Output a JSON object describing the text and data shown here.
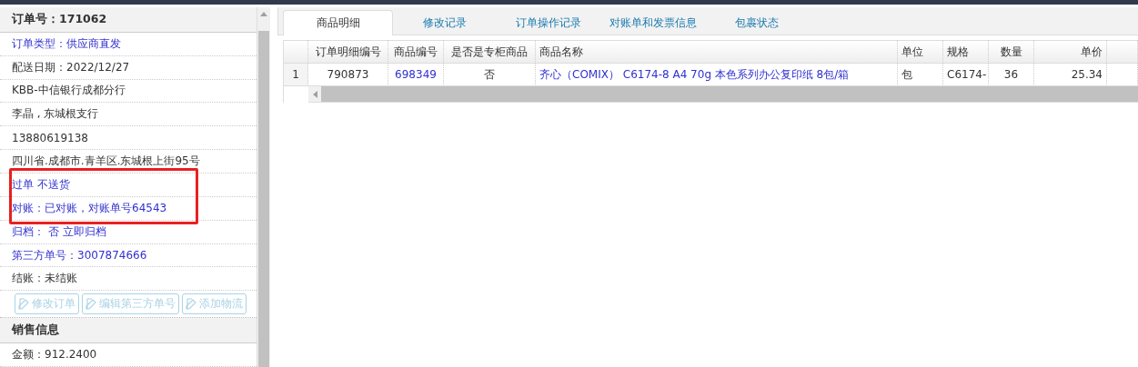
{
  "order_panel": {
    "title": "订单号：171062",
    "rows": [
      {
        "text": "订单类型：供应商直发",
        "kind": "link"
      },
      {
        "text": "配送日期：2022/12/27",
        "kind": "plain"
      },
      {
        "text": "KBB-中信银行成都分行",
        "kind": "plain"
      },
      {
        "text": "李晶 , 东城根支行",
        "kind": "plain"
      },
      {
        "text": "13880619138",
        "kind": "plain"
      },
      {
        "text": "四川省.成都市.青羊区.东城根上街95号",
        "kind": "plain"
      },
      {
        "text": "过单 不送货",
        "kind": "link"
      },
      {
        "text": "对账：已对账，对账单号64543",
        "kind": "link"
      },
      {
        "text": "归档：  否 立即归档",
        "kind": "link"
      },
      {
        "text": "第三方单号：3007874666",
        "kind": "link"
      },
      {
        "text": "结账：未结账",
        "kind": "plain"
      }
    ],
    "buttons": [
      {
        "label": "修改订单",
        "disabled": true
      },
      {
        "label": "编辑第三方单号",
        "disabled": true
      },
      {
        "label": "添加物流",
        "disabled": true
      }
    ]
  },
  "sales_panel": {
    "title": "销售信息",
    "rows": [
      {
        "text": "金额：912.2400",
        "kind": "plain"
      }
    ]
  },
  "tabs": [
    {
      "label": "商品明细",
      "selected": true
    },
    {
      "label": "修改记录",
      "selected": false
    },
    {
      "label": "订单操作记录",
      "selected": false
    },
    {
      "label": "对账单和发票信息",
      "selected": false
    },
    {
      "label": "包裹状态",
      "selected": false
    }
  ],
  "table": {
    "columns": [
      "订单明细编号",
      "商品编号",
      "是否是专柜商品",
      "商品名称",
      "单位",
      "规格",
      "数量",
      "单价"
    ],
    "rows": [
      {
        "index": "1",
        "cells": [
          "790873",
          "698349",
          "否",
          "齐心（COMIX） C6174-8 A4 70g 本色系列办公复印纸 8包/箱",
          "包",
          "C6174-",
          "36",
          "25.34"
        ]
      }
    ]
  }
}
